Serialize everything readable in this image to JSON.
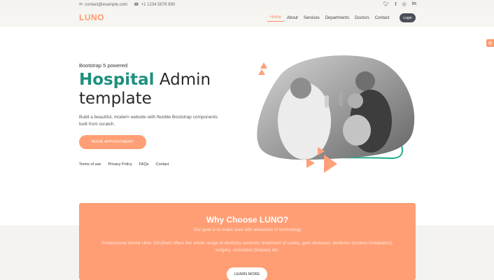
{
  "topbar": {
    "email": "contact@example.com",
    "phone": "+1 1234 5678 890",
    "social": [
      "twitter-icon",
      "facebook-icon",
      "instagram-icon",
      "linkedin-icon"
    ]
  },
  "navbar": {
    "brand": "LUNO",
    "items": [
      "Home",
      "About",
      "Services",
      "Departments",
      "Doctors",
      "Contact"
    ],
    "active": "Home",
    "login": "Login"
  },
  "hero": {
    "tagline": "Bootstrap 5 powered",
    "title_accent": "Hospital",
    "title_rest": "Admin template",
    "description": "Build a beautiful, modern website with flexible Bootstrap components built from scratch.",
    "cta": "BOOK APPOINTMENT",
    "links": [
      "Terms of use",
      "Privacy Policy",
      "FAQs",
      "Contact"
    ]
  },
  "why": {
    "title": "Why Choose LUNO?",
    "subtitle": "Our goal is to make sure with advances in technology",
    "body": "Professional dental clinic 32roDent offers the whole range of dentistry services: treatment of caries, gum diseases, dentures (crowns installation), surgery, correction (braces) etc.",
    "button": "LEARN MORE"
  },
  "colors": {
    "accent": "#ff9a6c",
    "teal": "#1f8f7e",
    "dark": "#4a4f58"
  }
}
